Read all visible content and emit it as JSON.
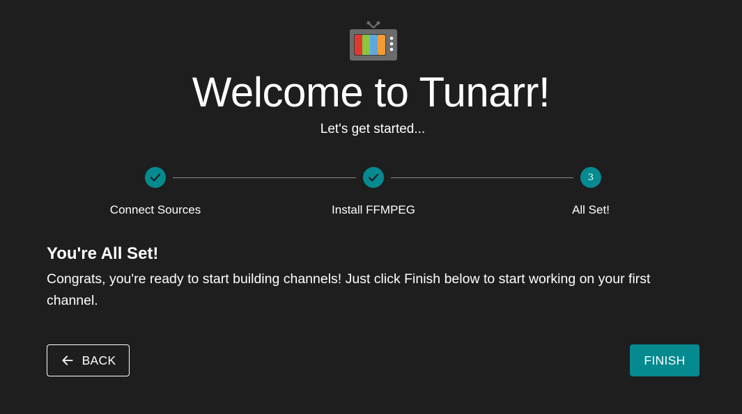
{
  "header": {
    "logo_icon": "tv-icon",
    "title": "Welcome to Tunarr!",
    "subtitle": "Let's get started..."
  },
  "stepper": {
    "steps": [
      {
        "label": "Connect Sources",
        "status": "completed",
        "icon": "check-icon"
      },
      {
        "label": "Install FFMPEG",
        "status": "completed",
        "icon": "check-icon"
      },
      {
        "label": "All Set!",
        "status": "active",
        "number": "3"
      }
    ]
  },
  "content": {
    "heading": "You're All Set!",
    "body": "Congrats, you're ready to start building channels! Just click Finish below to start working on your first channel."
  },
  "actions": {
    "back_label": "BACK",
    "back_icon": "arrow-left-icon",
    "finish_label": "FINISH"
  },
  "colors": {
    "background": "#1e1e1f",
    "accent": "#058a90",
    "text": "#ffffff",
    "connector": "#8a8a8a"
  }
}
